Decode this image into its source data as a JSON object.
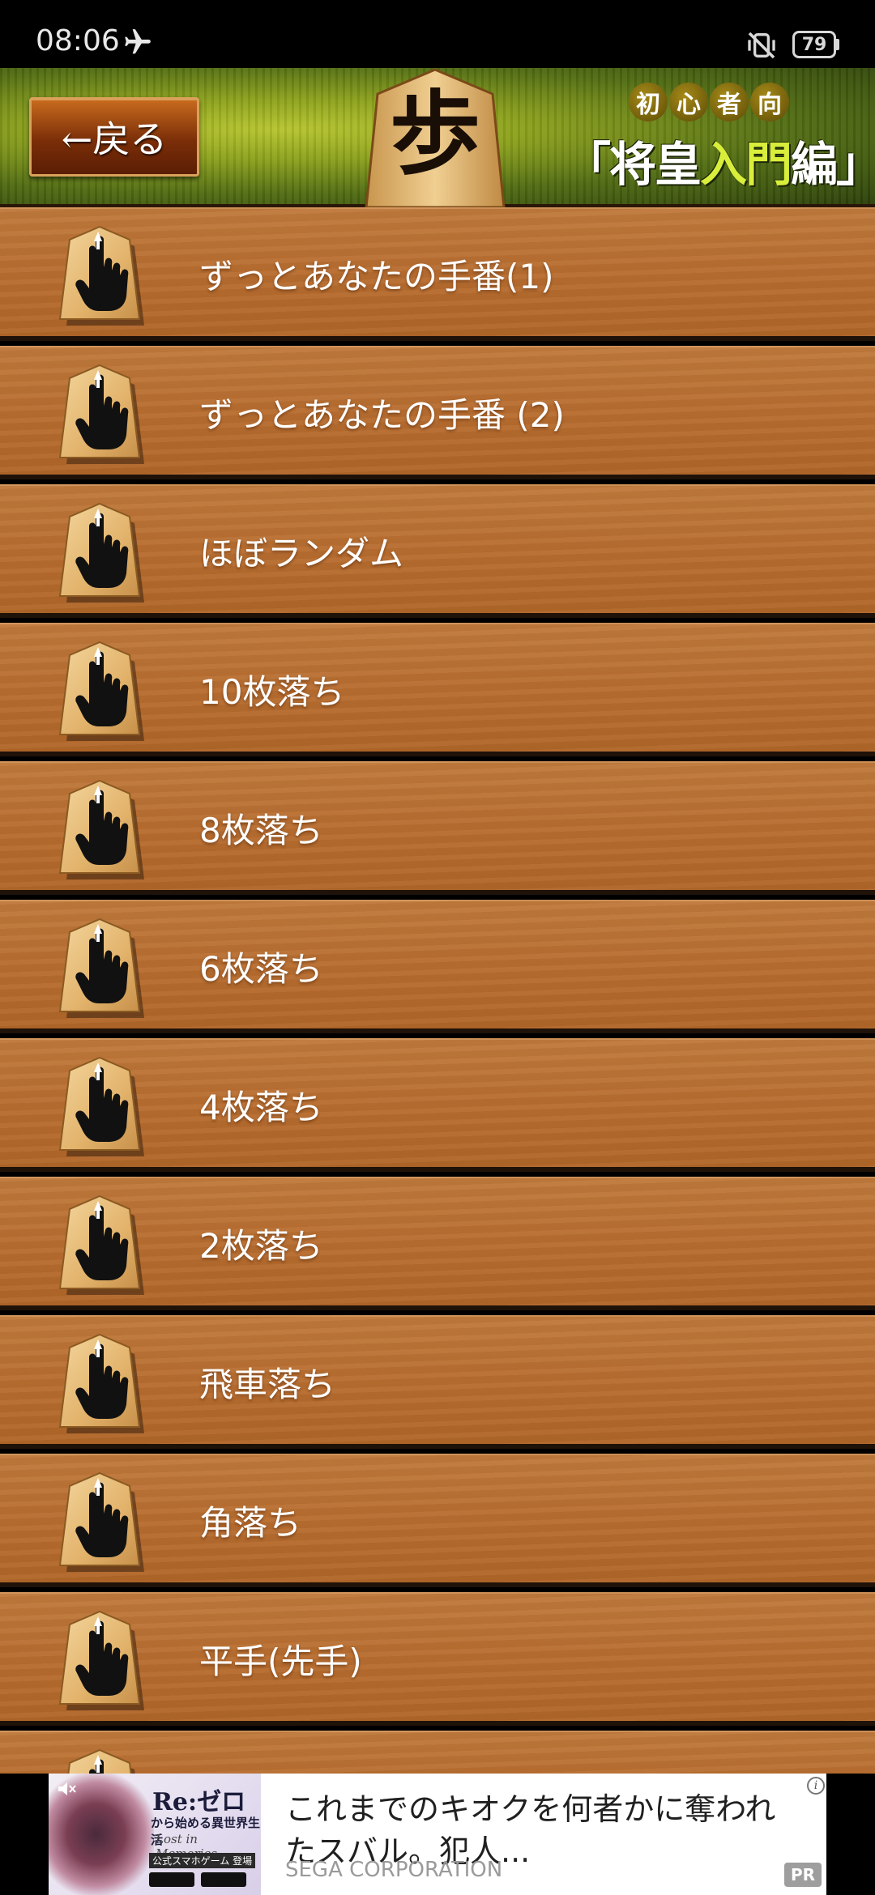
{
  "status_bar": {
    "time": "08:06",
    "battery_level": "79",
    "icons": [
      "airplane-icon",
      "vibrate-off-icon",
      "battery-icon"
    ]
  },
  "header": {
    "back_label": "←戻る",
    "piece_char": "歩",
    "level_badges": [
      "初",
      "心",
      "者",
      "向"
    ],
    "title_open": "「将皇",
    "title_highlight": "入門",
    "title_close": "編」",
    "colors": {
      "header_green": "#8da21c",
      "highlight": "#d8ee3a",
      "back_button": "#7b2e08"
    }
  },
  "menu": {
    "items": [
      {
        "label": "ずっとあなたの手番(1)"
      },
      {
        "label": "ずっとあなたの手番 (2)"
      },
      {
        "label": "ほぼランダム"
      },
      {
        "label": "10枚落ち"
      },
      {
        "label": "8枚落ち"
      },
      {
        "label": "6枚落ち"
      },
      {
        "label": "4枚落ち"
      },
      {
        "label": "2枚落ち"
      },
      {
        "label": "飛車落ち"
      },
      {
        "label": "角落ち"
      },
      {
        "label": "平手(先手)"
      }
    ],
    "item_icon": "shogi-piece-pointer-icon",
    "colors": {
      "wood": "#b86d30",
      "divider": "#1f1209"
    }
  },
  "ad": {
    "image_title": "Re:ゼロ",
    "image_subtitle": "から始める異世界生活",
    "image_script": "Lost in Memories",
    "image_tag": "公式スマホゲーム 登場",
    "text": "これまでのキオクを何者かに奪われたスバル。犯人...",
    "advertiser": "SEGA CORPORATION",
    "pr_badge": "PR",
    "info_glyph": "i"
  }
}
